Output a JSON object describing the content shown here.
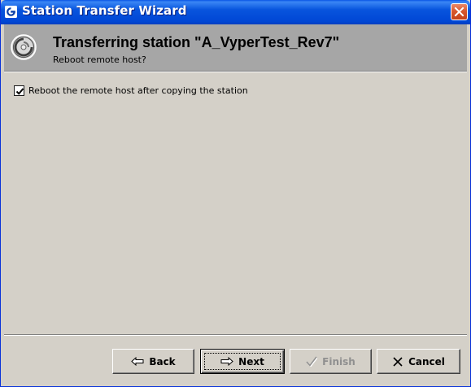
{
  "window": {
    "title": "Station Transfer Wizard",
    "title_bar_color": "#0855dd",
    "close_icon": "close-icon"
  },
  "header": {
    "title": "Transferring station \"A_VyperTest_Rev7\"",
    "subtitle": "Reboot remote host?",
    "icon": "wizard-ring-icon",
    "background_color": "#a6a6a6"
  },
  "content": {
    "reboot_checkbox": {
      "label": "Reboot the remote host after copying the station",
      "checked": true
    }
  },
  "buttons": {
    "back": {
      "label": "Back",
      "icon": "arrow-left-icon",
      "enabled": true
    },
    "next": {
      "label": "Next",
      "icon": "arrow-right-icon",
      "enabled": true,
      "focused": true
    },
    "finish": {
      "label": "Finish",
      "icon": "checkmark-icon",
      "enabled": false
    },
    "cancel": {
      "label": "Cancel",
      "icon": "x-icon",
      "enabled": true
    }
  }
}
